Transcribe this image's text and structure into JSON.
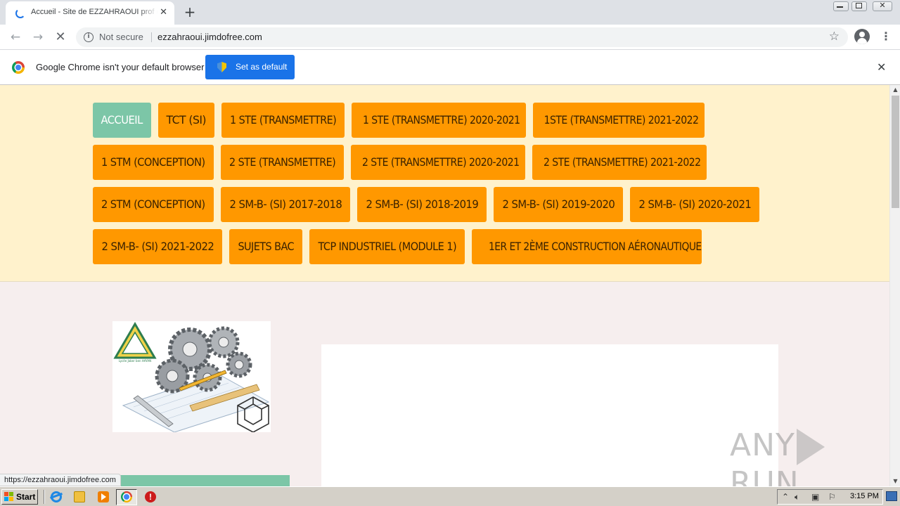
{
  "browser": {
    "tab_title": "Accueil - Site de EZZAHRAOUI prof d",
    "tab_close": "✕",
    "new_tab": "+",
    "back": "←",
    "forward": "→",
    "stop": "✕",
    "security_label": "Not secure",
    "url": "ezzahraoui.jimdofree.com",
    "bookmark_icon": "☆",
    "menu_icon": "⋮",
    "minimize": "",
    "maximize": "",
    "close": "✕"
  },
  "infobar": {
    "message": "Google Chrome isn't your default browser",
    "button": "Set as default",
    "close": "✕"
  },
  "site": {
    "nav": [
      {
        "label": "ACCUEIL",
        "active": true
      },
      {
        "label": "TCT (SI)"
      },
      {
        "label": "1 STE (TRANSMETTRE)"
      },
      {
        "label": "1 STE (TRANSMETTRE) 2020-2021"
      },
      {
        "label": "1STE (TRANSMETTRE) 2021-2022"
      },
      {
        "label": "1 STM (CONCEPTION)"
      },
      {
        "label": "2 STE (TRANSMETTRE)"
      },
      {
        "label": "2 STE (TRANSMETTRE) 2020-2021"
      },
      {
        "label": "2 STE (TRANSMETTRE) 2021-2022"
      },
      {
        "label": "2 STM (CONCEPTION)"
      },
      {
        "label": "2 SM-B- (SI) 2017-2018"
      },
      {
        "label": "2 SM-B- (SI) 2018-2019"
      },
      {
        "label": "2 SM-B- (SI) 2019-2020"
      },
      {
        "label": "2 SM-B- (SI) 2020-2021"
      },
      {
        "label": "2 SM-B- (SI) 2021-2022"
      },
      {
        "label": "SUJETS BAC"
      },
      {
        "label": "TCP INDUSTRIEL (MODULE 1)"
      },
      {
        "label": "1ER ET 2ÈME CONSTRUCTION AÉRONAUTIQUE"
      }
    ],
    "logo_text": "Lycée Jaber ben HAYAN",
    "colors": {
      "nav_button": "#ff9800",
      "nav_active": "#7cc6a7",
      "nav_band": "#fff2cc",
      "page_bg": "#f6eeee"
    }
  },
  "watermark": {
    "left": "ANY",
    "right": "RUN"
  },
  "status_url": "https://ezzahraoui.jimdofree.com",
  "taskbar": {
    "start": "Start",
    "clock": "3:15 PM",
    "tray_icons": [
      "chevron-up",
      "volume",
      "network",
      "flag"
    ]
  }
}
